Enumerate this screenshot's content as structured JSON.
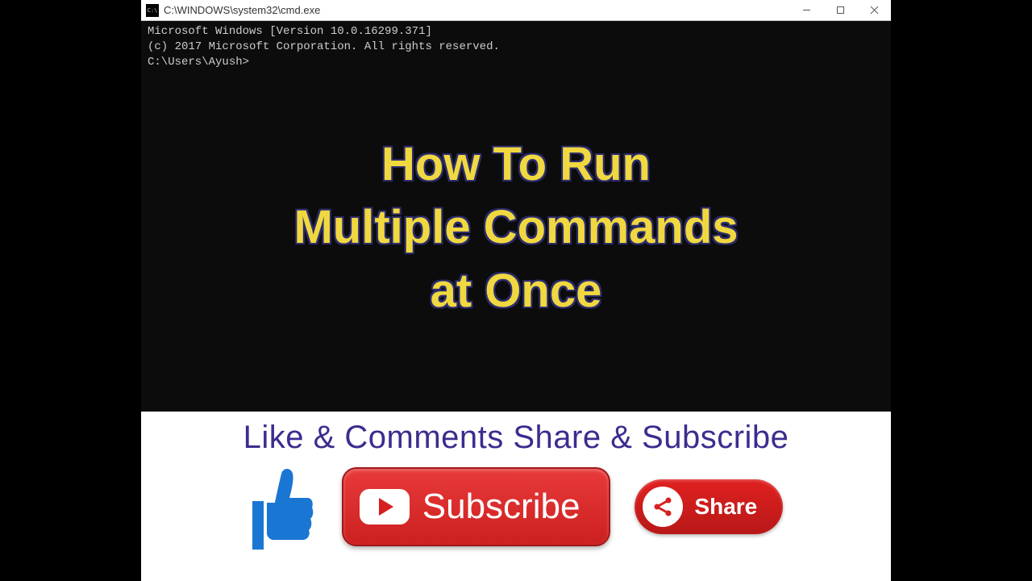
{
  "window": {
    "title": "C:\\WINDOWS\\system32\\cmd.exe"
  },
  "terminal": {
    "line1": "Microsoft Windows [Version 10.0.16299.371]",
    "line2": "(c) 2017 Microsoft Corporation. All rights reserved.",
    "line3": "",
    "prompt": "C:\\Users\\Ayush>"
  },
  "overlay": {
    "line1": "How To Run",
    "line2": "Multiple Commands",
    "line3": "at Once"
  },
  "cta": {
    "text": "Like & Comments Share & Subscribe",
    "subscribe_label": "Subscribe",
    "share_label": "Share"
  }
}
